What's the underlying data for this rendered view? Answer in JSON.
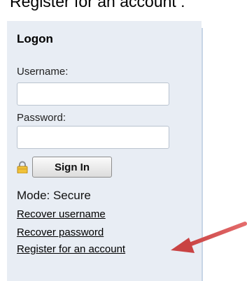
{
  "top_caption": "Register for an account :",
  "logon": {
    "title": "Logon",
    "username_label": "Username:",
    "username_value": "",
    "password_label": "Password:",
    "password_value": "",
    "lock_icon": "lock-icon",
    "sign_in_label": "Sign In",
    "mode_text": "Mode: Secure",
    "links": {
      "recover_username": "Recover username",
      "recover_password": "Recover password",
      "register": "Register for an account"
    }
  },
  "annotation": {
    "arrow_icon": "arrow-icon",
    "arrow_color": "#d64a4a"
  }
}
